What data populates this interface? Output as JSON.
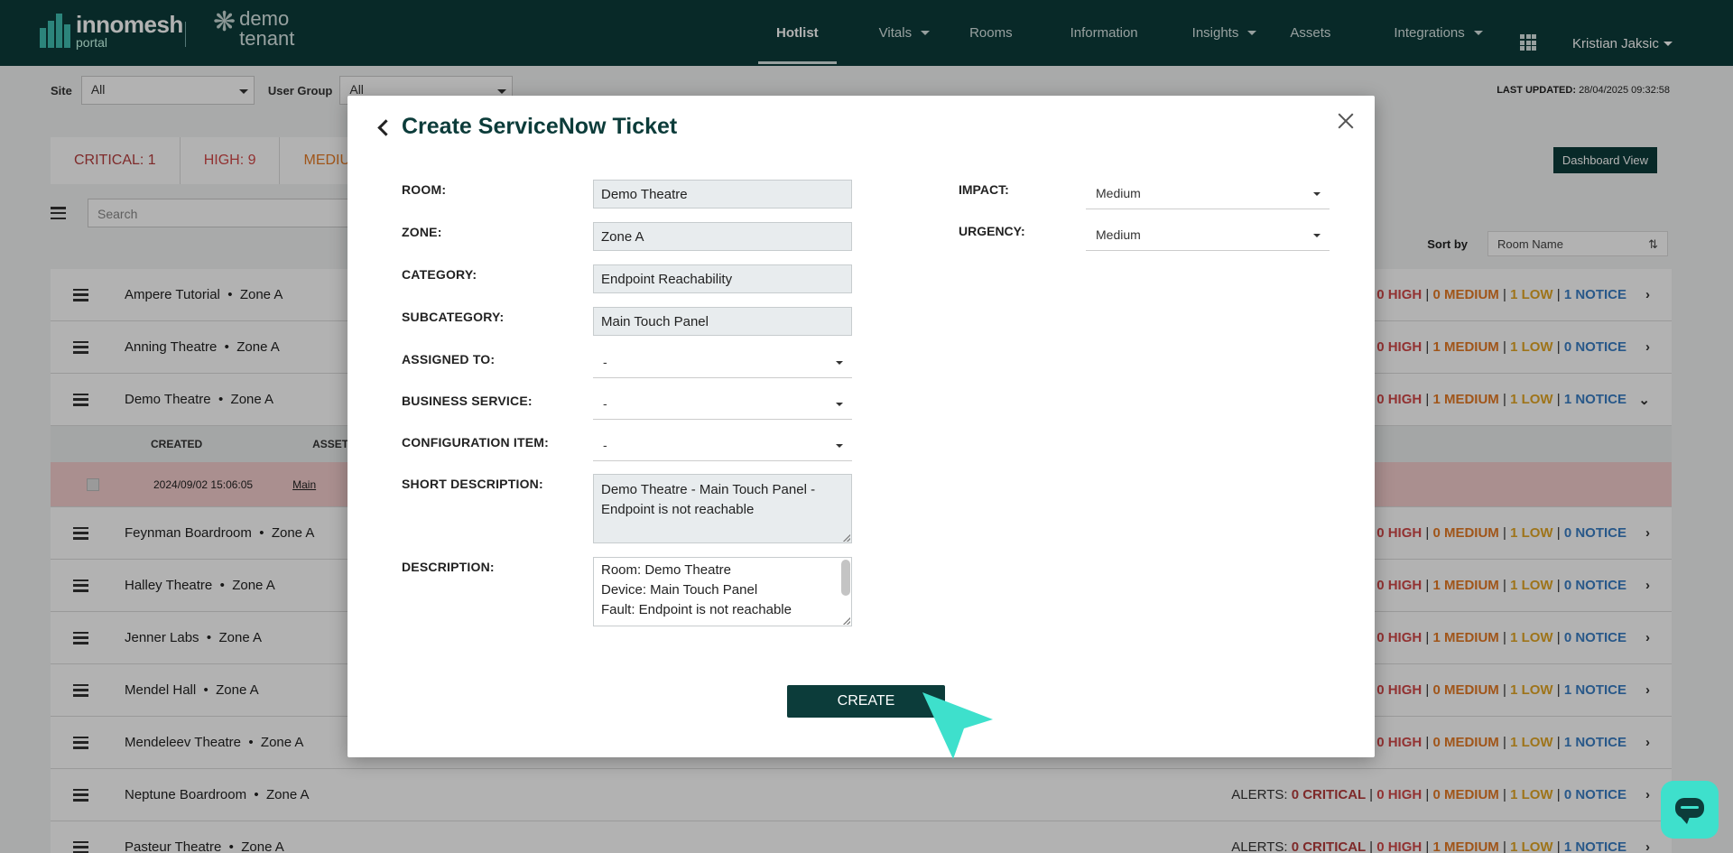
{
  "brand": {
    "name": "innomesh",
    "sub": "portal"
  },
  "tenant": {
    "line1": "demo",
    "line2": "tenant"
  },
  "nav": {
    "items": [
      {
        "label": "Hotlist",
        "active": true,
        "dropdown": false
      },
      {
        "label": "Vitals",
        "active": false,
        "dropdown": true
      },
      {
        "label": "Rooms",
        "active": false,
        "dropdown": false
      },
      {
        "label": "Information",
        "active": false,
        "dropdown": false
      },
      {
        "label": "Insights",
        "active": false,
        "dropdown": true
      },
      {
        "label": "Assets",
        "active": false,
        "dropdown": false
      },
      {
        "label": "Integrations",
        "active": false,
        "dropdown": true
      }
    ],
    "user": "Kristian Jaksic"
  },
  "filters": {
    "site_label": "Site",
    "site_value": "All",
    "group_label": "User Group",
    "group_value": "All"
  },
  "last_updated": {
    "label": "LAST UPDATED:",
    "value": "28/04/2025 09:32:58"
  },
  "summary": {
    "critical": "CRITICAL: 1",
    "high": "HIGH: 9",
    "medium": "MEDIU"
  },
  "dashboard_button": "Dashboard View",
  "search_placeholder": "Search",
  "sort": {
    "label": "Sort by",
    "value": "Room Name"
  },
  "rooms": [
    {
      "name": "Ampere Tutorial",
      "zone": "Zone A",
      "high": "0 HIGH",
      "medium": "0 MEDIUM",
      "low": "1 LOW",
      "notice": "1 NOTICE",
      "prefix": "|",
      "expanded": false
    },
    {
      "name": "Anning Theatre",
      "zone": "Zone A",
      "high": "0 HIGH",
      "medium": "1 MEDIUM",
      "low": "1 LOW",
      "notice": "0 NOTICE",
      "prefix": "|",
      "expanded": false
    },
    {
      "name": "Demo Theatre",
      "zone": "Zone A",
      "high": "0 HIGH",
      "medium": "1 MEDIUM",
      "low": "1 LOW",
      "notice": "1 NOTICE",
      "prefix": "|",
      "expanded": true
    },
    {
      "name": "Feynman Boardroom",
      "zone": "Zone A",
      "high": "0 HIGH",
      "medium": "0 MEDIUM",
      "low": "1 LOW",
      "notice": "0 NOTICE",
      "prefix": "|",
      "expanded": false
    },
    {
      "name": "Halley Theatre",
      "zone": "Zone A",
      "high": "0 HIGH",
      "medium": "1 MEDIUM",
      "low": "1 LOW",
      "notice": "0 NOTICE",
      "prefix": "|",
      "expanded": false
    },
    {
      "name": "Jenner Labs",
      "zone": "Zone A",
      "high": "0 HIGH",
      "medium": "1 MEDIUM",
      "low": "1 LOW",
      "notice": "0 NOTICE",
      "prefix": "|",
      "expanded": false
    },
    {
      "name": "Mendel Hall",
      "zone": "Zone A",
      "high": "0 HIGH",
      "medium": "0 MEDIUM",
      "low": "1 LOW",
      "notice": "1 NOTICE",
      "prefix": "|",
      "expanded": false
    },
    {
      "name": "Mendeleev Theatre",
      "zone": "Zone A",
      "high": "0 HIGH",
      "medium": "0 MEDIUM",
      "low": "1 LOW",
      "notice": "1 NOTICE",
      "prefix": "|",
      "expanded": false
    },
    {
      "name": "Neptune Boardroom",
      "zone": "Zone A",
      "prefix": "ALERTS:",
      "critical": "0 CRITICAL",
      "high": "0 HIGH",
      "medium": "0 MEDIUM",
      "low": "1 LOW",
      "notice": "0 NOTICE",
      "expanded": false
    },
    {
      "name": "Pasteur Theatre",
      "zone": "Zone A",
      "prefix": "ALERTS:",
      "critical": "0 CRITICAL",
      "high": "0 HIGH",
      "medium": "1 MEDIUM",
      "low": "1 LOW",
      "notice": "1 NOTICE",
      "expanded": false
    }
  ],
  "sub_table": {
    "col_created": "CREATED",
    "col_asset": "ASSET",
    "row_created": "2024/09/02 15:06:05",
    "row_asset": "Main"
  },
  "modal": {
    "title": "Create ServiceNow Ticket",
    "room_label": "ROOM:",
    "room_value": "Demo Theatre",
    "zone_label": "ZONE:",
    "zone_value": "Zone A",
    "category_label": "CATEGORY:",
    "category_value": "Endpoint Reachability",
    "subcategory_label": "SUBCATEGORY:",
    "subcategory_value": "Main Touch Panel",
    "assigned_label": "ASSIGNED TO:",
    "assigned_value": "-",
    "business_label": "BUSINESS SERVICE:",
    "business_value": "-",
    "config_label": "CONFIGURATION ITEM:",
    "config_value": "-",
    "short_desc_label": "SHORT DESCRIPTION:",
    "short_desc_value": "Demo Theatre - Main Touch Panel - Endpoint is not reachable",
    "desc_label": "DESCRIPTION:",
    "desc_lines": [
      "Room: Demo Theatre",
      "Device: Main Touch Panel",
      "Fault: Endpoint is not reachable"
    ],
    "impact_label": "IMPACT:",
    "impact_value": "Medium",
    "urgency_label": "URGENCY:",
    "urgency_value": "Medium",
    "create_label": "CREATE"
  },
  "colors": {
    "brand_dark": "#0c3c3a",
    "accent": "#3ee0cc",
    "critical": "#b53d3d",
    "high": "#d24848",
    "medium": "#e57a25",
    "low": "#e2a726",
    "notice": "#3a7ec4"
  }
}
